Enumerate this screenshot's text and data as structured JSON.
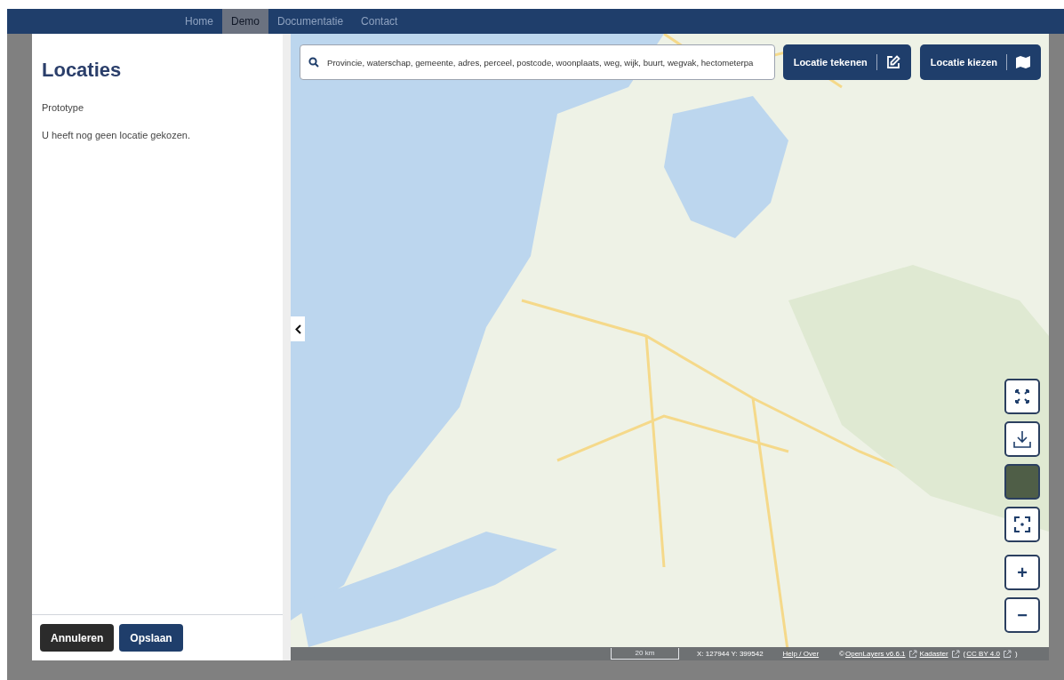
{
  "nav": {
    "items": [
      {
        "label": "Home",
        "selected": false
      },
      {
        "label": "Demo",
        "selected": true
      },
      {
        "label": "Documentatie",
        "selected": false
      },
      {
        "label": "Contact",
        "selected": false
      }
    ]
  },
  "panel": {
    "title": "Locaties",
    "subtitle": "Prototype",
    "message": "U heeft nog geen locatie gekozen.",
    "buttons": [
      {
        "label": "Annuleren",
        "kind": "secondary"
      },
      {
        "label": "Opslaan",
        "kind": "primary"
      }
    ]
  },
  "map": {
    "search": {
      "placeholder": "Provincie, waterschap, gemeente, adres, perceel, postcode, woonplaats, weg, wijk, buurt, wegvak, hectometerpa"
    },
    "actions": [
      {
        "label": "Locatie tekenen",
        "kind": "draw"
      },
      {
        "label": "Locatie kiezen",
        "kind": "choose"
      }
    ],
    "controls": [
      {
        "kind": "fullscreen"
      },
      {
        "kind": "download"
      },
      {
        "kind": "layer"
      },
      {
        "kind": "locate"
      },
      {
        "kind": "zoom",
        "label": "+"
      },
      {
        "kind": "zoom",
        "label": "−"
      }
    ],
    "status_bar": {
      "scale": "20 km",
      "coordinates": "X: 127944 Y: 399542",
      "help_link": "Help / Over",
      "attributions": [
        {
          "kind": "text",
          "label": "©"
        },
        {
          "kind": "link",
          "label": "OpenLayers v6.6.1"
        },
        {
          "kind": "link",
          "label": "Kadaster"
        },
        {
          "kind": "text",
          "label": "("
        },
        {
          "kind": "link",
          "label": "CC BY 4.0"
        },
        {
          "kind": "text",
          "label": ")"
        }
      ]
    }
  }
}
